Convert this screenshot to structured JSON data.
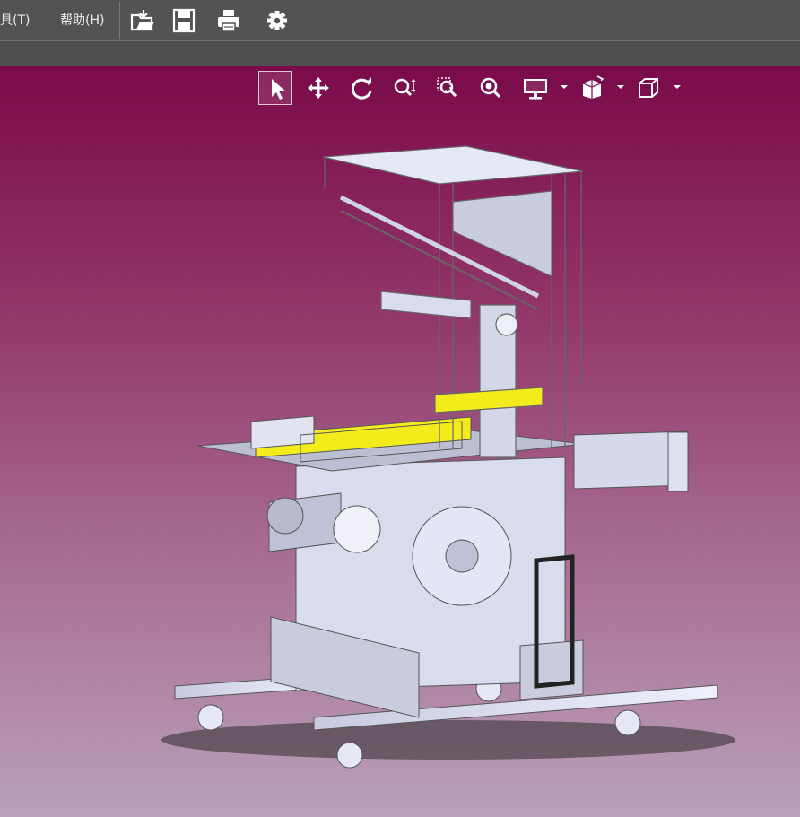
{
  "menubar": {
    "items": [
      {
        "label": "工具(T)"
      },
      {
        "label": "帮助(H)"
      }
    ],
    "tools": [
      "open-file-icon",
      "save-icon",
      "print-icon",
      "settings-gear-icon"
    ]
  },
  "viewport": {
    "toolbar": [
      "select-arrow-icon",
      "pan-move-icon",
      "rotate-icon",
      "zoom-icon",
      "zoom-window-icon",
      "zoom-fit-icon",
      "display-mode-icon",
      "view-orientation-icon",
      "cube-view-icon"
    ],
    "active_tool": "select-arrow-icon",
    "colors": {
      "gradient_top": "#7b0a4a",
      "gradient_bottom": "#b9a0b8",
      "model_body": "#dcdff0",
      "model_highlight": "#f2ec1c"
    }
  }
}
